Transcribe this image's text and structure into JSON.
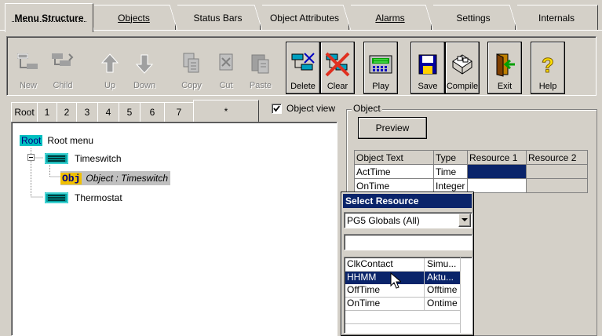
{
  "top_tabs": [
    {
      "label": "Menu Structure",
      "active": true
    },
    {
      "label": "Objects",
      "active": false
    },
    {
      "label": "Status Bars",
      "active": false
    },
    {
      "label": "Object Attributes",
      "active": false
    },
    {
      "label": "Alarms",
      "active": false
    },
    {
      "label": "Settings",
      "active": false
    },
    {
      "label": "Internals",
      "active": false
    }
  ],
  "toolbar": {
    "new": "New",
    "child": "Child",
    "up": "Up",
    "down": "Down",
    "copy": "Copy",
    "cut": "Cut",
    "paste": "Paste",
    "delete": "Delete",
    "clear": "Clear",
    "play": "Play",
    "save": "Save",
    "compile": "Compile",
    "exit": "Exit",
    "help": "Help"
  },
  "sub_tabs": [
    "Root",
    "1",
    "2",
    "3",
    "4",
    "5",
    "6",
    "7",
    "*"
  ],
  "object_view": {
    "label": "Object view",
    "checked": true
  },
  "tree": {
    "root_badge": "Root",
    "root_label": "Root menu",
    "timeswitch": "Timeswitch",
    "obj_badge": "Obj",
    "obj_label": "Object : Timeswitch",
    "thermostat": "Thermostat"
  },
  "object_group": {
    "label": "Object",
    "preview": "Preview",
    "columns": [
      "Object Text",
      "Type",
      "Resource 1",
      "Resource 2"
    ],
    "rows": [
      [
        "ActTime",
        "Time",
        "",
        ""
      ],
      [
        "OnTime",
        "Integer",
        "",
        ""
      ]
    ]
  },
  "select_resource": {
    "title": "Select Resource",
    "dropdown_value": "PG5 Globals  (All)",
    "filter_value": "",
    "items": [
      [
        "ClkContact",
        "Simu..."
      ],
      [
        "HHMM",
        "Aktu..."
      ],
      [
        "OffTime",
        "Offtime"
      ],
      [
        "OnTime",
        "Ontime"
      ]
    ],
    "selected_index": 1
  },
  "colors": {
    "face": "#d4d0c8",
    "selection": "#0a246a",
    "highlight_cyan": "#00c0c0",
    "obj_badge": "#f0c000"
  }
}
